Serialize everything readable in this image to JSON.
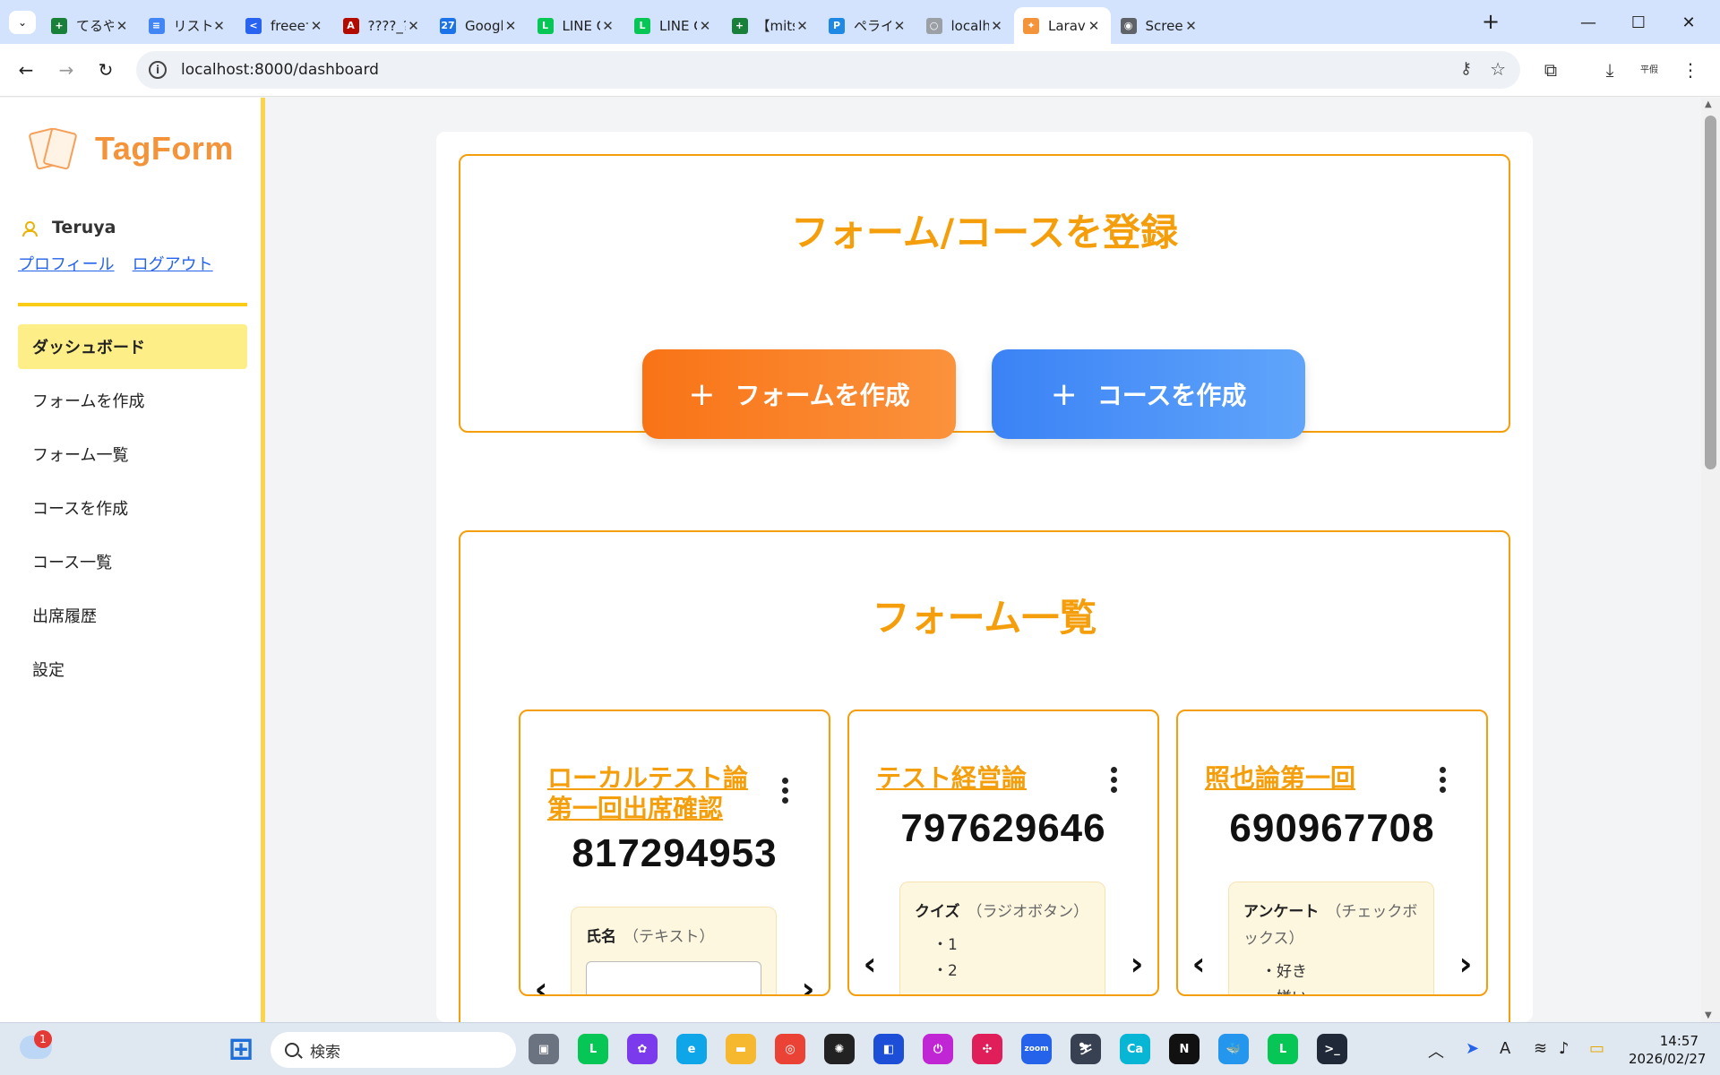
{
  "browser": {
    "tabs": [
      {
        "title": "てるやの",
        "color": "#188038",
        "glyph": "+"
      },
      {
        "title": "リストミ",
        "color": "#4285f4",
        "glyph": "≡"
      },
      {
        "title": "freeeサ",
        "color": "#2864f0",
        "glyph": "<"
      },
      {
        "title": "????_??",
        "color": "#b30b00",
        "glyph": "A"
      },
      {
        "title": "Google",
        "color": "#1a73e8",
        "glyph": "27"
      },
      {
        "title": "LINE C",
        "color": "#06c755",
        "glyph": "L"
      },
      {
        "title": "LINE C",
        "color": "#06c755",
        "glyph": "L"
      },
      {
        "title": "【mitsu",
        "color": "#188038",
        "glyph": "+"
      },
      {
        "title": "ペライチ",
        "color": "#1e88e5",
        "glyph": "P"
      },
      {
        "title": "localhc",
        "color": "#9aa0a6",
        "glyph": "○"
      },
      {
        "title": "Larave",
        "color": "#f3933a",
        "glyph": "✦"
      },
      {
        "title": "Screen",
        "color": "#5f6368",
        "glyph": "◉"
      }
    ],
    "active_tab": 10,
    "url": "localhost:8000/dashboard",
    "tab_search_glyph": "⌄",
    "new_tab_glyph": "+",
    "minimize_glyph": "—",
    "maximize_glyph": "☐",
    "close_glyph": "✕",
    "back_glyph": "←",
    "forward_glyph": "→",
    "reload_glyph": "↻",
    "info_glyph": "i",
    "key_glyph": "⚷",
    "star_glyph": "☆",
    "extensions_glyph": "⧉",
    "download_glyph": "⤓",
    "translate_glyph": "平假",
    "menu_glyph": "⋮"
  },
  "sidebar": {
    "brand": "TagForm",
    "user_name": "Teruya",
    "profile_link": "プロフィール",
    "logout_link": "ログアウト",
    "menu": [
      {
        "label": "ダッシュボード",
        "active": true
      },
      {
        "label": "フォームを作成",
        "active": false
      },
      {
        "label": "フォーム一覧",
        "active": false
      },
      {
        "label": "コースを作成",
        "active": false
      },
      {
        "label": "コース一覧",
        "active": false
      },
      {
        "label": "出席履歴",
        "active": false
      },
      {
        "label": "設定",
        "active": false
      }
    ]
  },
  "main": {
    "register_title": "フォーム/コースを登録",
    "create_form_label": "フォームを作成",
    "create_course_label": "コースを作成",
    "plus_glyph": "+",
    "list_title": "フォーム一覧",
    "prev_glyph": "‹",
    "next_glyph": "›",
    "forms": [
      {
        "title": "ローカルテスト論第一回出席確認",
        "code": "817294953",
        "question_label": "氏名",
        "question_type": "（テキスト）",
        "options": [],
        "has_text_input": true
      },
      {
        "title": "テスト経営論",
        "code": "797629646",
        "question_label": "クイズ",
        "question_type": "（ラジオボタン）",
        "options": [
          "・1",
          "・2"
        ],
        "has_text_input": false
      },
      {
        "title": "照也論第一回",
        "code": "690967708",
        "question_label": "アンケート",
        "question_type": "（チェックボックス）",
        "options": [
          "・好き",
          "・嫌い"
        ],
        "has_text_input": false
      }
    ]
  },
  "taskbar": {
    "search_placeholder": "検索",
    "notification_count": "1",
    "time": "14:57",
    "date": "2026/02/27",
    "start_glyph": "⊞",
    "tray_chevron": "︿",
    "tray_ime": "A",
    "tray_wifi": "≋",
    "tray_volume": "♪",
    "tray_battery": "▭",
    "apps": [
      {
        "name": "task-view",
        "color": "#6b7280",
        "glyph": "▣"
      },
      {
        "name": "line",
        "color": "#06c755",
        "glyph": "L"
      },
      {
        "name": "copilot",
        "color": "#7c3aed",
        "glyph": "✿"
      },
      {
        "name": "edge",
        "color": "#0ea5e9",
        "glyph": "e"
      },
      {
        "name": "explorer",
        "color": "#f5b82e",
        "glyph": "▬"
      },
      {
        "name": "chrome",
        "color": "#ea4335",
        "glyph": "◎"
      },
      {
        "name": "chatgpt",
        "color": "#222222",
        "glyph": "✺"
      },
      {
        "name": "app",
        "color": "#1d4ed8",
        "glyph": "◧"
      },
      {
        "name": "toggl",
        "color": "#c026d3",
        "glyph": "⏻"
      },
      {
        "name": "slack",
        "color": "#e01e5a",
        "glyph": "✣"
      },
      {
        "name": "zoom",
        "color": "#2563eb",
        "glyph": "zoom"
      },
      {
        "name": "app",
        "color": "#374151",
        "glyph": "⛷"
      },
      {
        "name": "canva",
        "color": "#06b6d4",
        "glyph": "Ca"
      },
      {
        "name": "notion",
        "color": "#111111",
        "glyph": "N"
      },
      {
        "name": "docker",
        "color": "#2496ed",
        "glyph": "🐳"
      },
      {
        "name": "line",
        "color": "#06c755",
        "glyph": "L"
      },
      {
        "name": "terminal",
        "color": "#1f2937",
        "glyph": ">_"
      }
    ]
  }
}
